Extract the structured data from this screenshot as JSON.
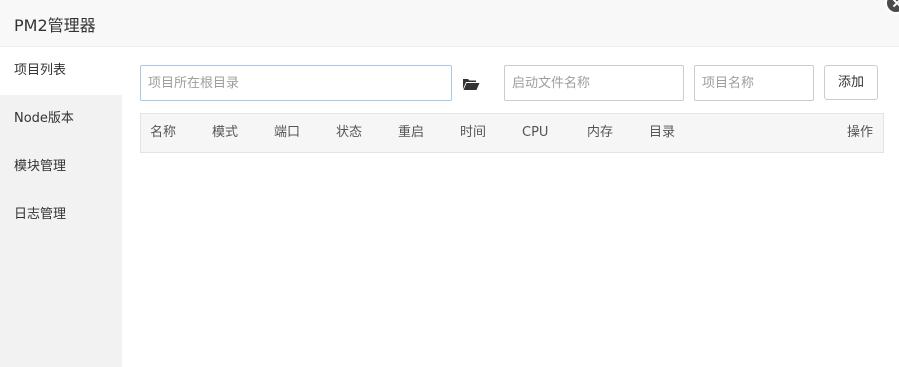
{
  "window": {
    "title": "PM2管理器"
  },
  "sidebar": {
    "items": [
      {
        "label": "项目列表",
        "active": true
      },
      {
        "label": "Node版本",
        "active": false
      },
      {
        "label": "模块管理",
        "active": false
      },
      {
        "label": "日志管理",
        "active": false
      }
    ]
  },
  "form": {
    "root_placeholder": "项目所在根目录",
    "file_placeholder": "启动文件名称",
    "name_placeholder": "项目名称",
    "add_label": "添加"
  },
  "table": {
    "headers": [
      "名称",
      "模式",
      "端口",
      "状态",
      "重启",
      "时间",
      "CPU",
      "内存",
      "目录",
      "操作"
    ],
    "rows": []
  },
  "icons": {
    "folder": "folder-open-icon",
    "close": "close-icon"
  },
  "colors": {
    "input_focus_border": "#a8c8e6",
    "sidebar_bg": "#f2f2f2"
  }
}
